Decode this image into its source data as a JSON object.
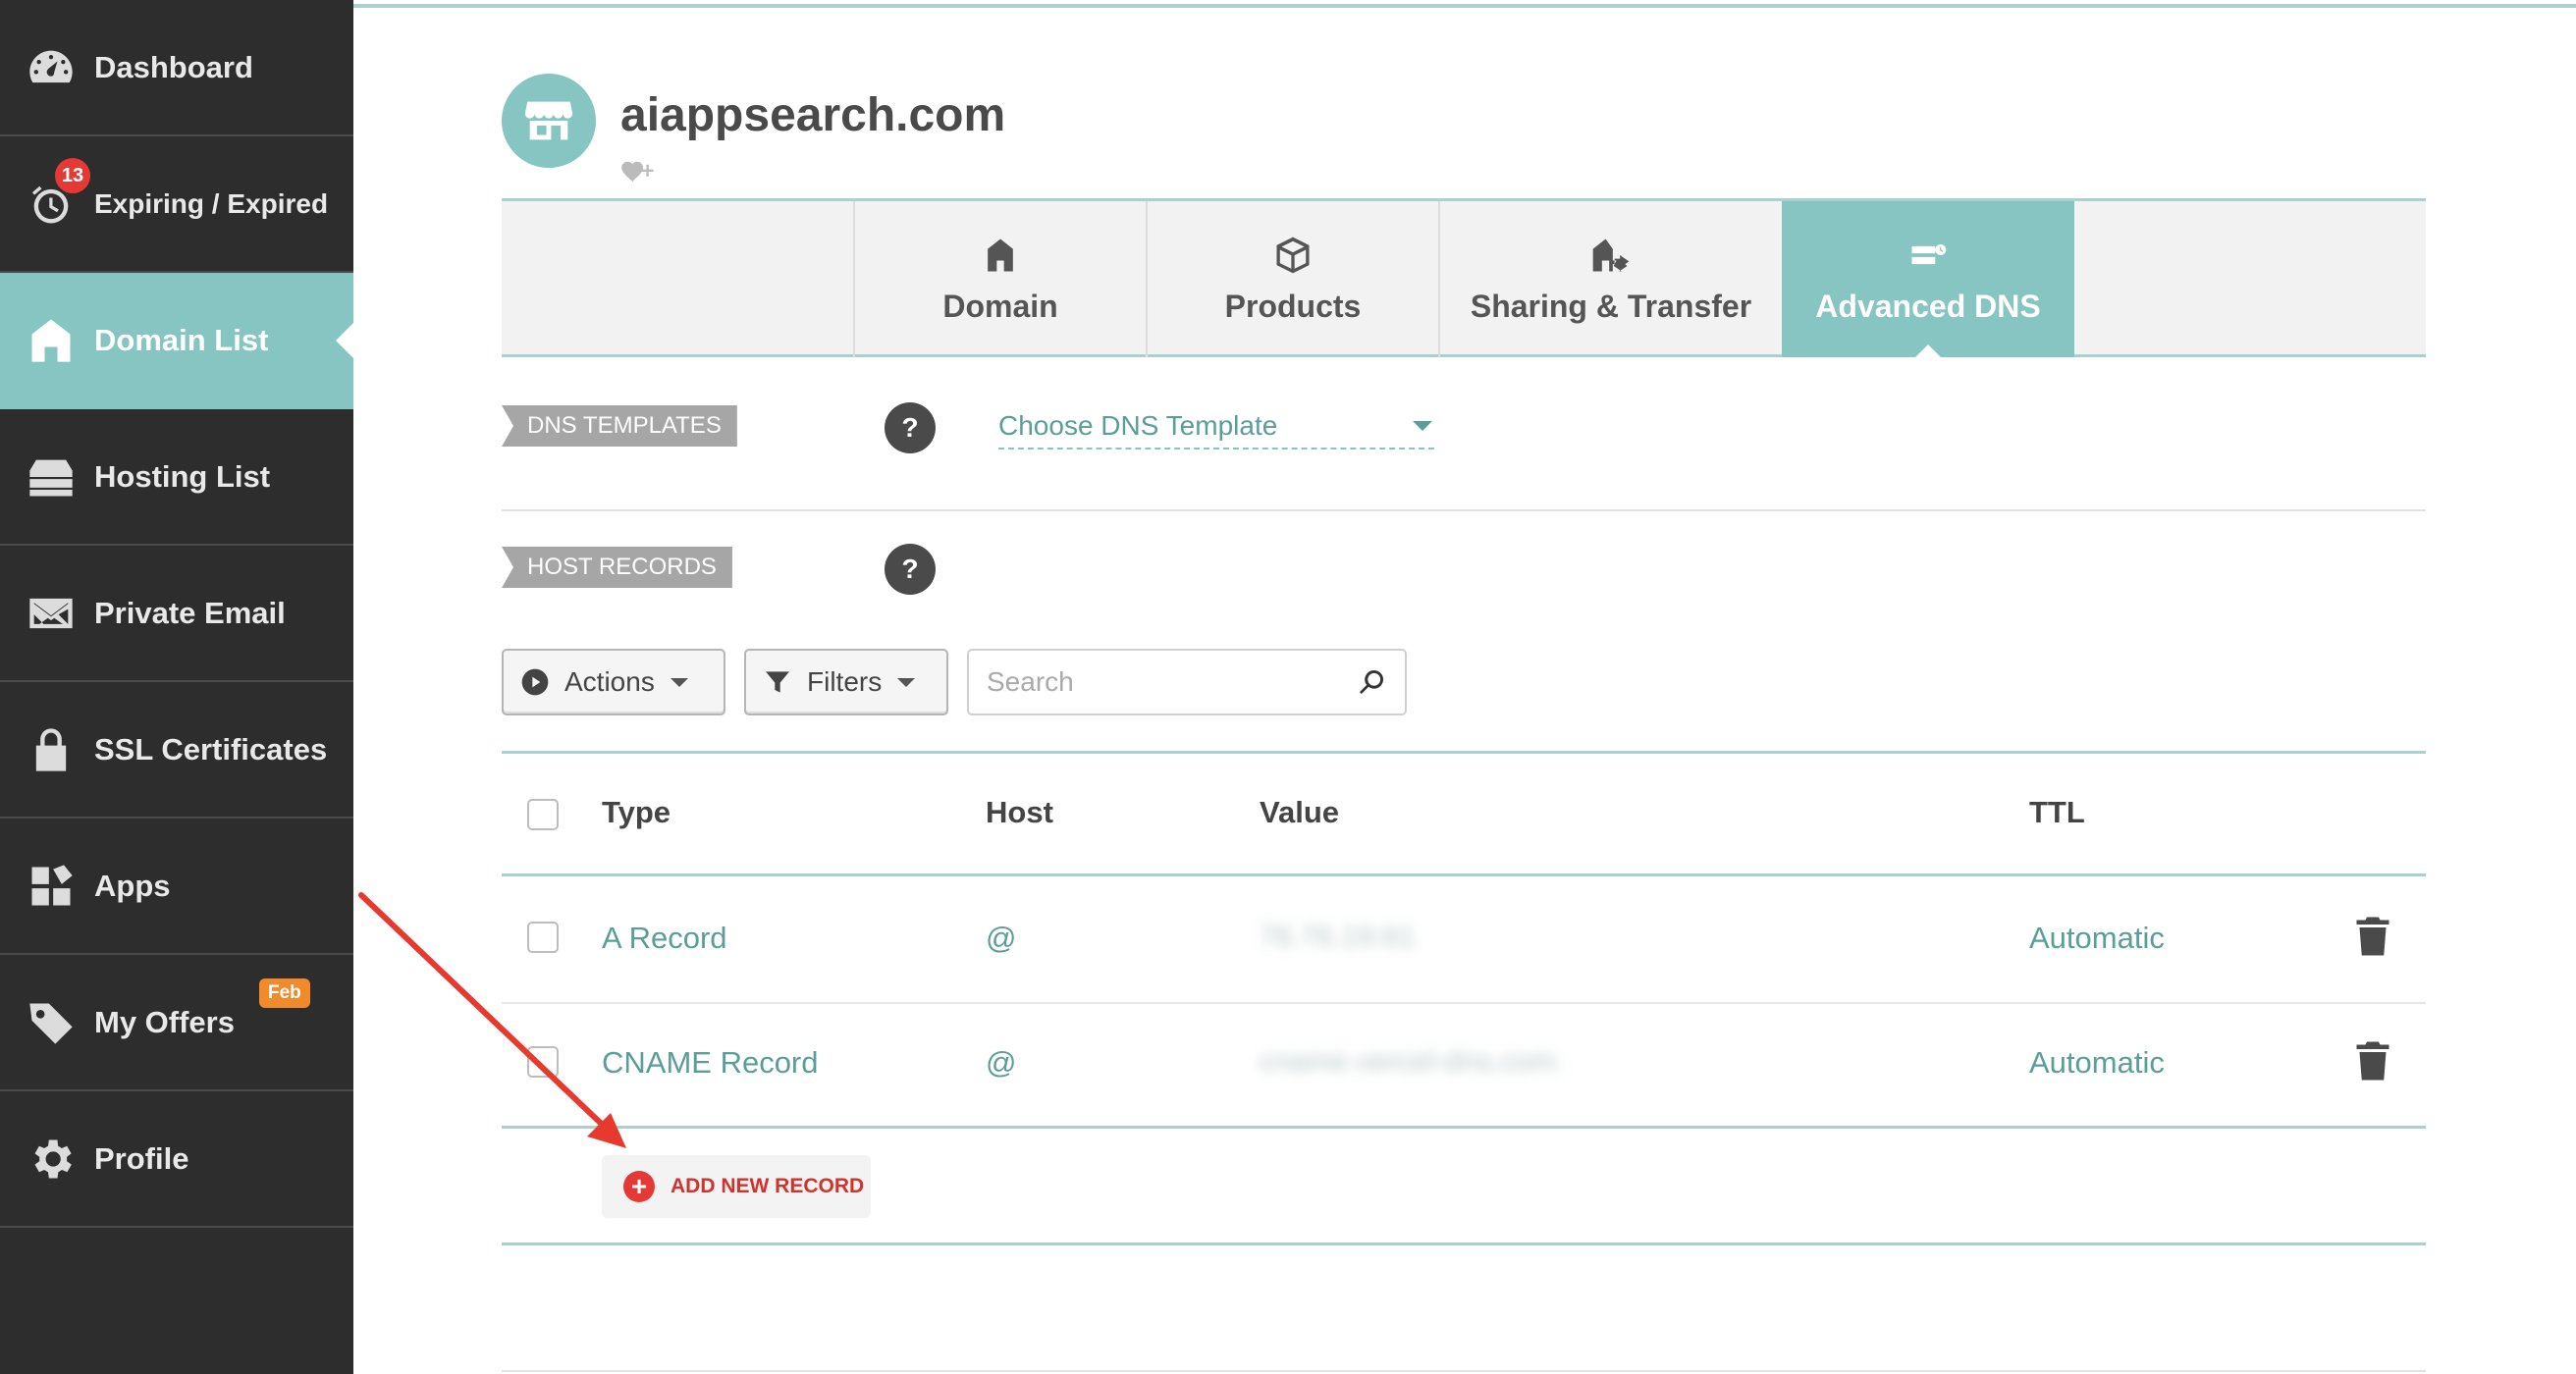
{
  "sidebar": {
    "items": [
      {
        "label": "Dashboard",
        "icon": "dashboard-icon"
      },
      {
        "label": "Expiring / Expired",
        "icon": "clock-icon",
        "badge": "13"
      },
      {
        "label": "Domain List",
        "icon": "home-icon",
        "active": true
      },
      {
        "label": "Hosting List",
        "icon": "server-icon"
      },
      {
        "label": "Private Email",
        "icon": "envelope-icon"
      },
      {
        "label": "SSL Certificates",
        "icon": "lock-icon"
      },
      {
        "label": "Apps",
        "icon": "apps-icon"
      },
      {
        "label": "My Offers",
        "icon": "tag-icon",
        "badge": "Feb"
      },
      {
        "label": "Profile",
        "icon": "gear-icon"
      }
    ]
  },
  "domain": {
    "name": "aiappsearch.com"
  },
  "tabs": [
    {
      "label": "Domain",
      "icon": "home-icon"
    },
    {
      "label": "Products",
      "icon": "box-icon"
    },
    {
      "label": "Sharing & Transfer",
      "icon": "share-home-icon"
    },
    {
      "label": "Advanced DNS",
      "icon": "dns-icon",
      "active": true
    }
  ],
  "dns_templates": {
    "tag": "DNS TEMPLATES",
    "help": "?",
    "select_value": "Choose DNS Template"
  },
  "host_records": {
    "tag": "HOST RECORDS",
    "help": "?",
    "actions_label": "Actions",
    "filters_label": "Filters",
    "search_placeholder": "Search",
    "columns": [
      "Type",
      "Host",
      "Value",
      "TTL"
    ],
    "rows": [
      {
        "type": "A Record",
        "host": "@",
        "value": "76.76.19.61",
        "ttl": "Automatic"
      },
      {
        "type": "CNAME Record",
        "host": "@",
        "value": "cname.vercel-dns.com.",
        "ttl": "Automatic"
      }
    ],
    "add_label": "ADD NEW RECORD"
  },
  "colors": {
    "accent": "#86c5c2",
    "sidebar_bg": "#2d2d2d",
    "add_red": "#e53935",
    "annotation_arrow": "#e8392f"
  }
}
